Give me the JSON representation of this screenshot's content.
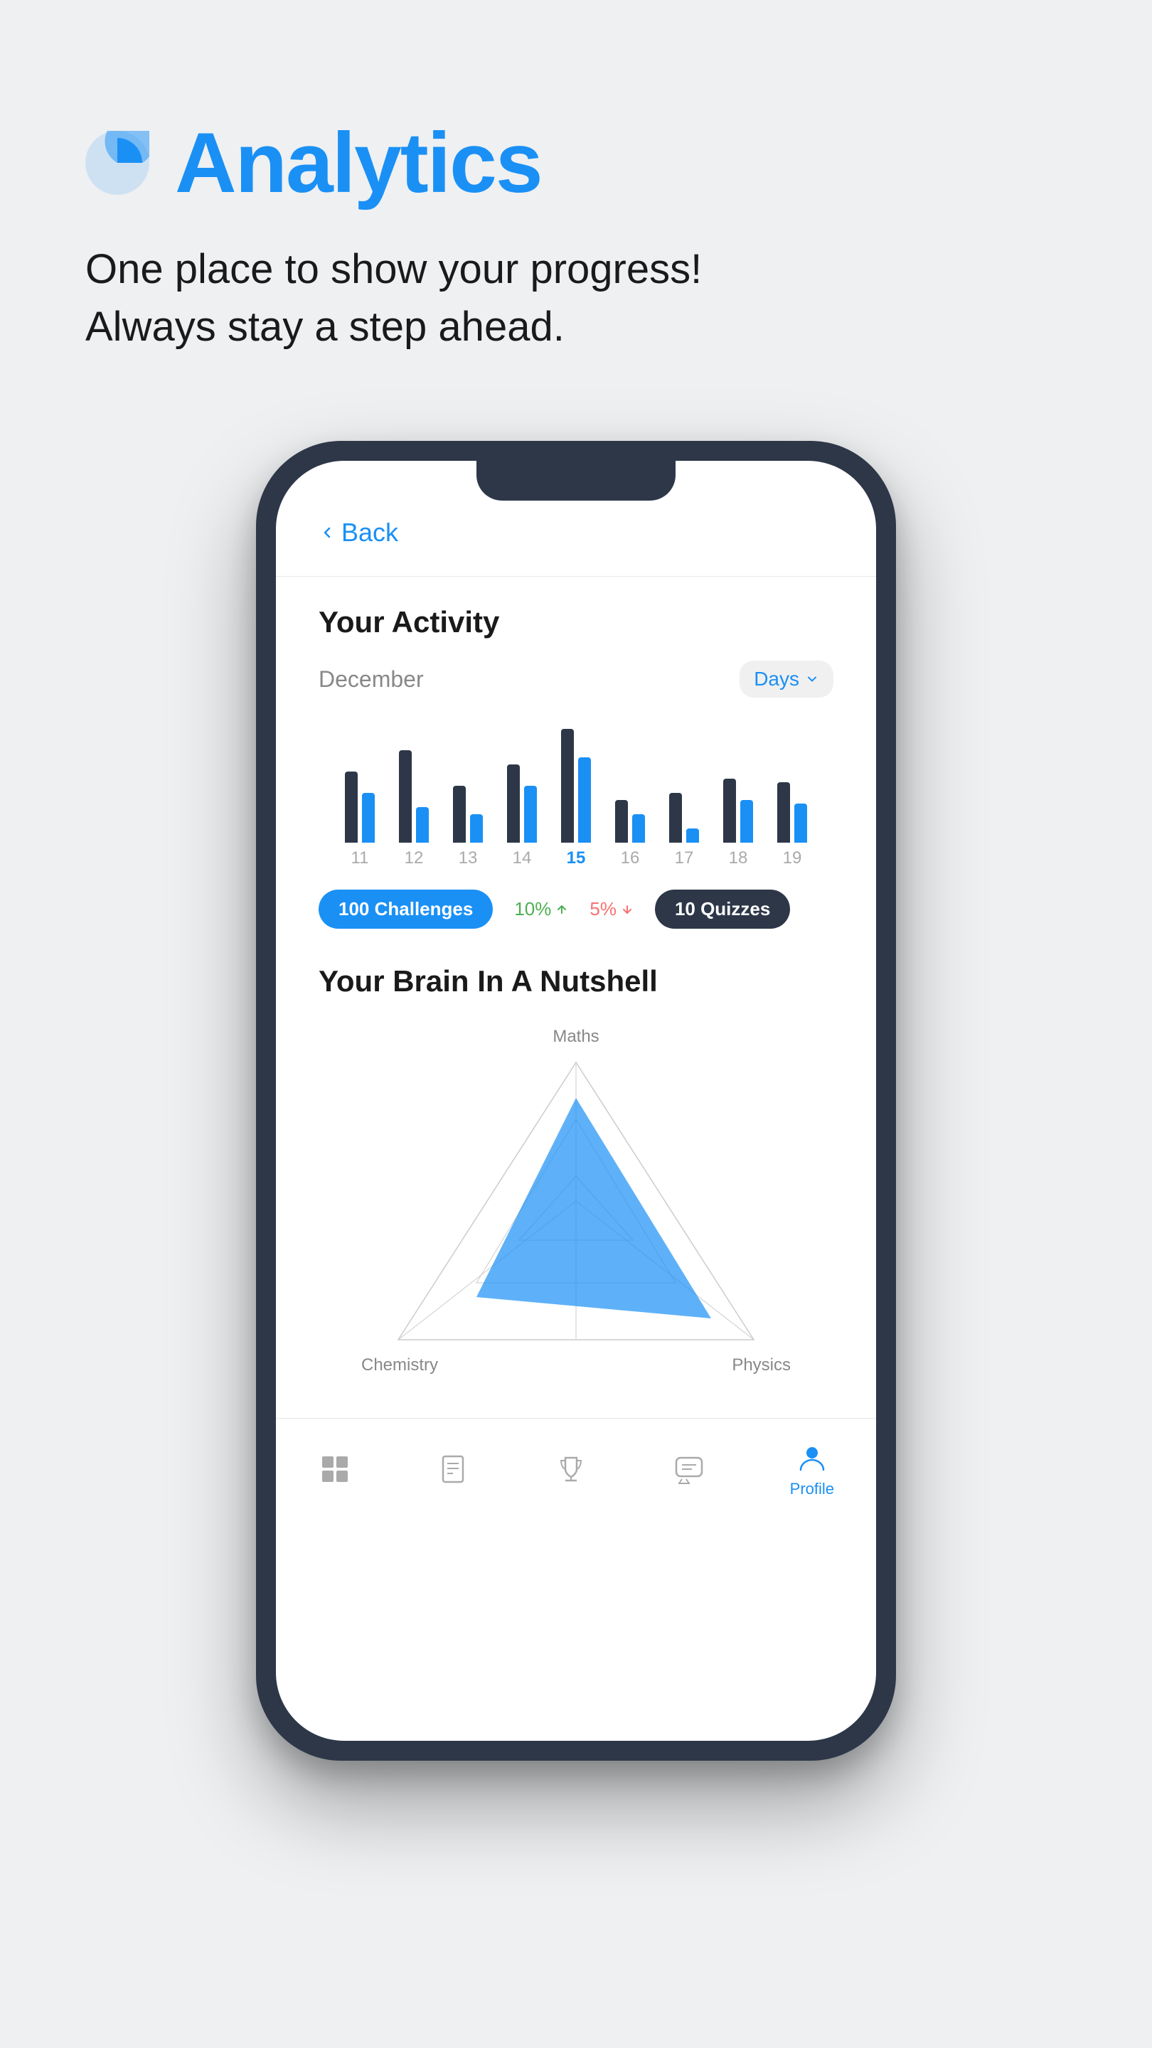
{
  "page": {
    "background": "#eef0f2"
  },
  "header": {
    "icon_label": "analytics-icon",
    "title": "Analytics",
    "subtitle_line1": "One place to show your progress!",
    "subtitle_line2": "Always stay a step ahead."
  },
  "phone": {
    "back_label": "Back",
    "activity_section": {
      "title": "Your Activity",
      "month": "December",
      "period_dropdown": "Days",
      "bars": [
        {
          "day": "11",
          "dark_height": 100,
          "blue_height": 70,
          "active": false
        },
        {
          "day": "12",
          "dark_height": 130,
          "blue_height": 50,
          "active": false
        },
        {
          "day": "13",
          "dark_height": 80,
          "blue_height": 40,
          "active": false
        },
        {
          "day": "14",
          "dark_height": 110,
          "blue_height": 80,
          "active": false
        },
        {
          "day": "15",
          "dark_height": 160,
          "blue_height": 120,
          "active": true
        },
        {
          "day": "16",
          "dark_height": 60,
          "blue_height": 40,
          "active": false
        },
        {
          "day": "17",
          "dark_height": 70,
          "blue_height": 20,
          "active": false
        },
        {
          "day": "18",
          "dark_height": 90,
          "blue_height": 60,
          "active": false
        },
        {
          "day": "19",
          "dark_height": 85,
          "blue_height": 55,
          "active": false
        }
      ],
      "badge_challenges": "100 Challenges",
      "pct_up": "10%",
      "pct_down": "5%",
      "badge_quizzes": "10 Quizzes"
    },
    "brain_section": {
      "title": "Your Brain In A Nutshell",
      "labels": {
        "top": "Maths",
        "bottom_left": "Chemistry",
        "bottom_right": "Physics"
      }
    },
    "nav": {
      "items": [
        {
          "label": "",
          "icon": "grid-icon",
          "active": false
        },
        {
          "label": "",
          "icon": "book-icon",
          "active": false
        },
        {
          "label": "",
          "icon": "trophy-icon",
          "active": false
        },
        {
          "label": "",
          "icon": "chat-icon",
          "active": false
        },
        {
          "label": "Profile",
          "icon": "profile-icon",
          "active": true
        }
      ]
    }
  }
}
